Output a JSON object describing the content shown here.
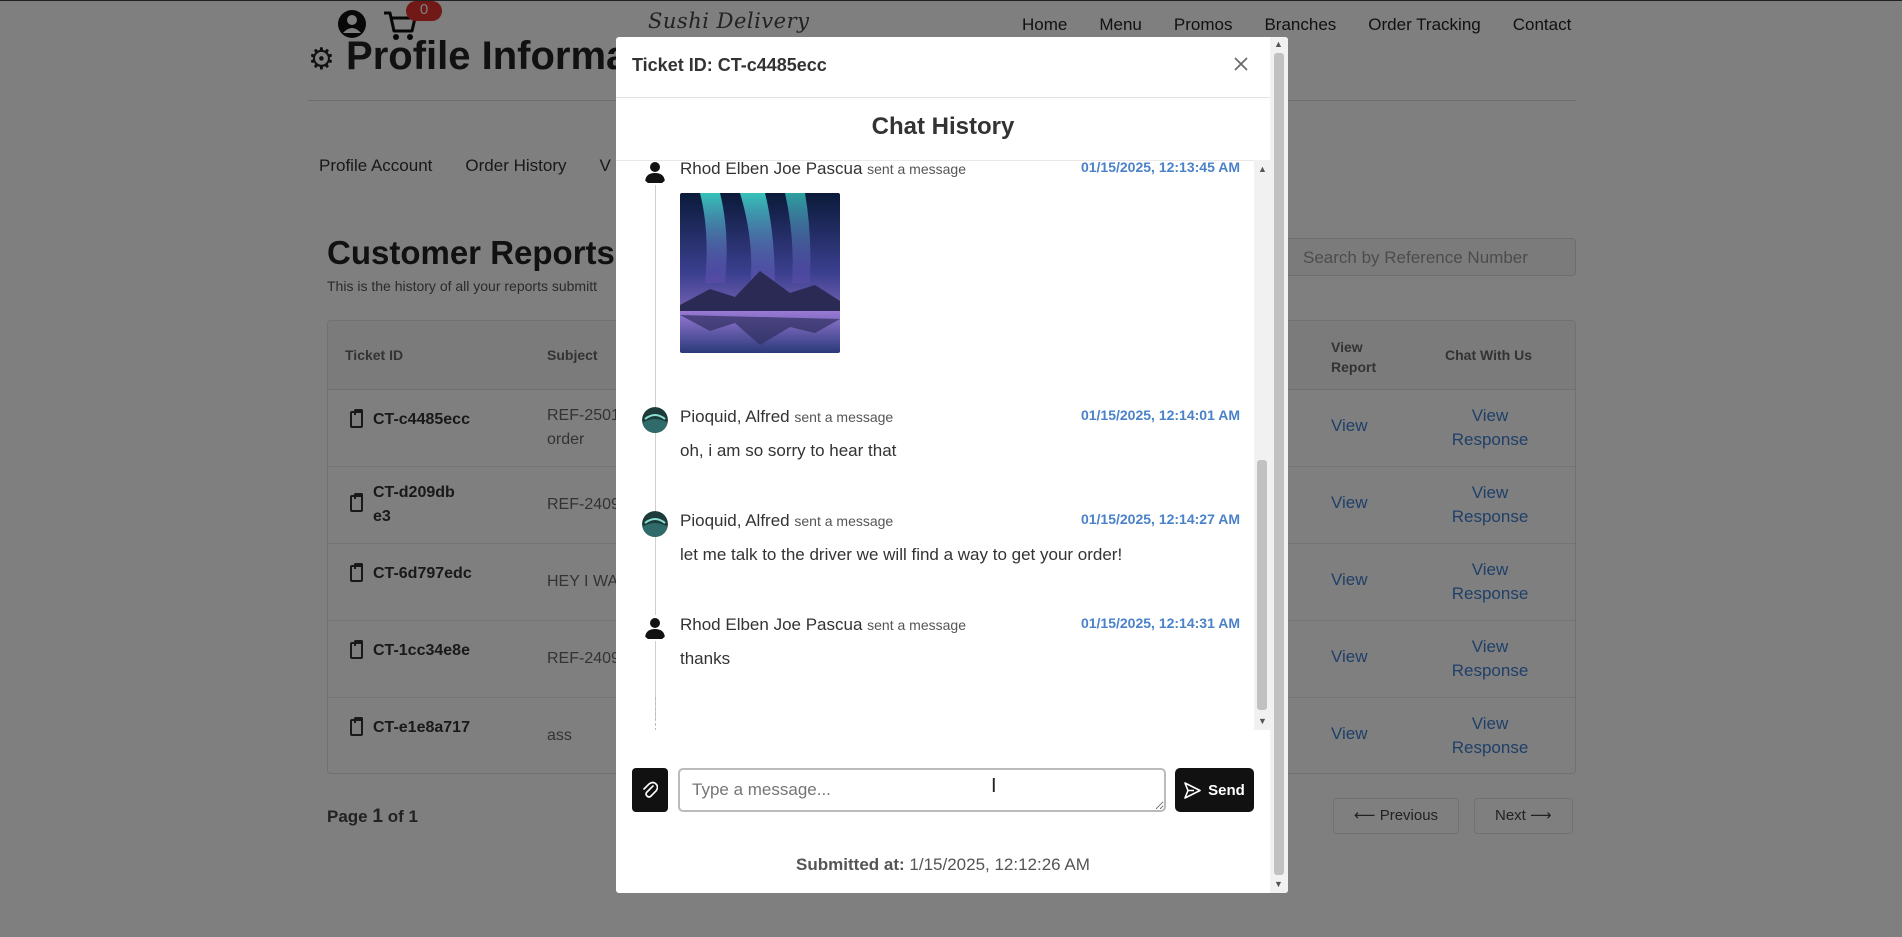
{
  "header": {
    "cart_count": "0",
    "logo": "Sushi Delivery",
    "nav": [
      "Home",
      "Menu",
      "Promos",
      "Branches",
      "Order Tracking",
      "Contact"
    ]
  },
  "profile": {
    "title": "Profile Information",
    "tabs": [
      "Profile Account",
      "Order History",
      "V"
    ]
  },
  "reports": {
    "title": "Customer Reports",
    "subtitle": "This is the history of all your reports submitt",
    "search_placeholder": "Search by Reference Number",
    "columns": {
      "ticket_id": "Ticket ID",
      "subject": "Subject",
      "view_report": "View Report",
      "chat": "Chat With Us"
    },
    "rows": [
      {
        "id": "CT-c4485ecc",
        "subject": "REF-2501 order",
        "view": "View",
        "response": "View Response"
      },
      {
        "id": "CT-d209dbe3",
        "subject": "REF-2409",
        "view": "View",
        "response": "View Response"
      },
      {
        "id": "CT-6d797edc",
        "subject": "HEY I WA",
        "view": "View",
        "response": "View Response"
      },
      {
        "id": "CT-1cc34e8e",
        "subject": "REF-2409",
        "view": "View",
        "response": "View Response"
      },
      {
        "id": "CT-e1e8a717",
        "subject": "ass",
        "view": "View",
        "response": "View Response"
      }
    ],
    "pager": {
      "page_prefix": "Page",
      "page": "1",
      "of": "of",
      "total": "1",
      "previous": "Previous",
      "next": "Next"
    }
  },
  "modal": {
    "ticket_title": "Ticket ID: CT-c4485ecc",
    "chat_title": "Chat History",
    "messages": [
      {
        "sender": "Rhod Elben Joe Pascua",
        "action": "sent a message",
        "time": "01/15/2025, 12:13:45 AM",
        "type": "image",
        "avatar": "person-icon"
      },
      {
        "sender": "Pioquid, Alfred",
        "action": "sent a message",
        "time": "01/15/2025, 12:14:01 AM",
        "text": "oh, i am so sorry to hear that",
        "avatar": "staff-avatar"
      },
      {
        "sender": "Pioquid, Alfred",
        "action": "sent a message",
        "time": "01/15/2025, 12:14:27 AM",
        "text": "let me talk to the driver we will find a way to get your order!",
        "avatar": "staff-avatar"
      },
      {
        "sender": "Rhod Elben Joe Pascua",
        "action": "sent a message",
        "time": "01/15/2025, 12:14:31 AM",
        "text": "thanks",
        "avatar": "person-icon"
      }
    ],
    "input_placeholder": "Type a message...",
    "send_label": "Send",
    "submitted_label": "Submitted at:",
    "submitted_value": "1/15/2025, 12:12:26 AM"
  },
  "colors": {
    "accent_link": "#3f7fd1",
    "timestamp": "#4a82c9",
    "badge": "#e0332f",
    "button_dark": "#111111"
  }
}
